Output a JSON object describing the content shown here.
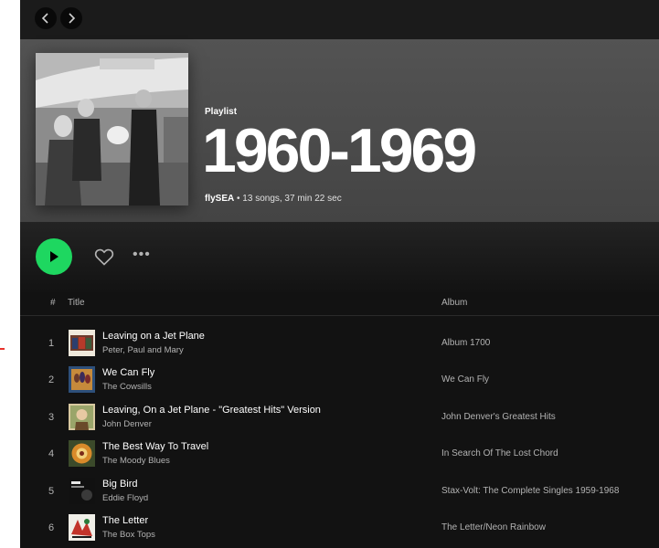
{
  "playlist": {
    "type_label": "Playlist",
    "title": "1960-1969",
    "owner": "flySEA",
    "stats": " • 13 songs, 37 min 22 sec"
  },
  "columns": {
    "number": "#",
    "title": "Title",
    "album": "Album"
  },
  "tracks": [
    {
      "number": "1",
      "title": "Leaving on a Jet Plane",
      "artist": "Peter, Paul and Mary",
      "album": "Album 1700"
    },
    {
      "number": "2",
      "title": "We Can Fly",
      "artist": "The Cowsills",
      "album": "We Can Fly"
    },
    {
      "number": "3",
      "title": "Leaving, On a Jet Plane - \"Greatest Hits\" Version",
      "artist": "John Denver",
      "album": "John Denver's Greatest Hits"
    },
    {
      "number": "4",
      "title": "The Best Way To Travel",
      "artist": "The Moody Blues",
      "album": "In Search Of The Lost Chord"
    },
    {
      "number": "5",
      "title": "Big Bird",
      "artist": "Eddie Floyd",
      "album": "Stax-Volt: The Complete Singles 1959-1968"
    },
    {
      "number": "6",
      "title": "The Letter",
      "artist": "The Box Tops",
      "album": "The Letter/Neon Rainbow"
    }
  ],
  "icons": {
    "back": "chevron-left-icon",
    "forward": "chevron-right-icon",
    "play": "play-icon",
    "like": "heart-icon",
    "more": "more-options-icon"
  },
  "colors": {
    "accent": "#1ed760",
    "background": "#121212",
    "header": "#535353",
    "text_primary": "#ffffff",
    "text_secondary": "#b3b3b3"
  }
}
